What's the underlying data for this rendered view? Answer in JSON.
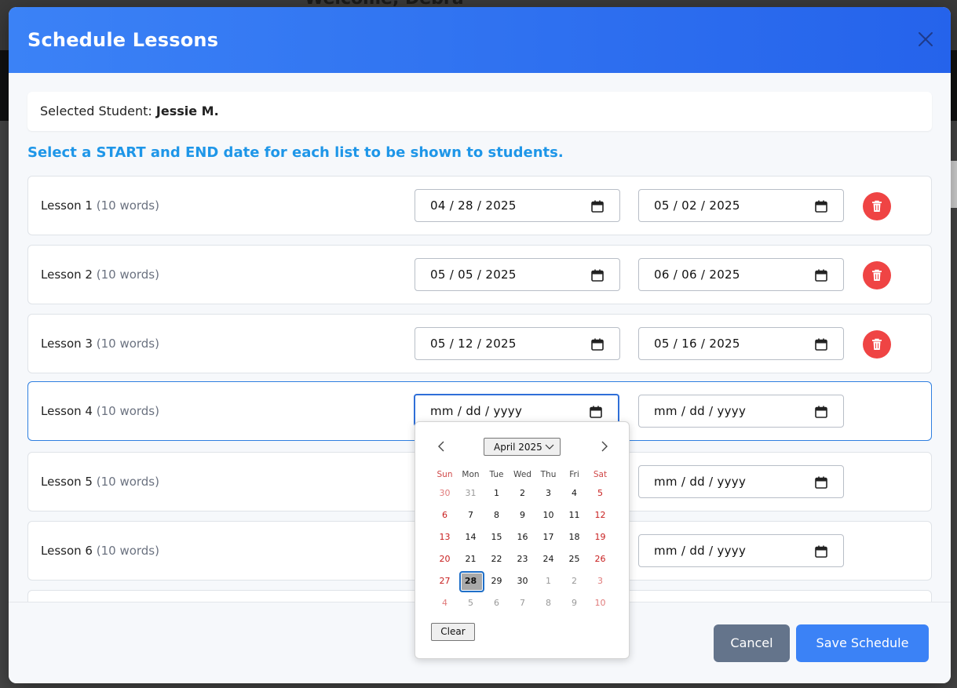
{
  "background": {
    "welcome_text": "Welcome, Debra"
  },
  "modal": {
    "title": "Schedule Lessons",
    "student_label": "Selected Student:",
    "student_name": "Jessie M.",
    "instruction": "Select a START and END date for each list to be shown to students.",
    "lessons": [
      {
        "name": "Lesson 1",
        "count": "(10 words)",
        "start": "04 / 28 / 2025",
        "end": "05 / 02 / 2025"
      },
      {
        "name": "Lesson 2",
        "count": "(10 words)",
        "start": "05 / 05 / 2025",
        "end": "06 / 06 / 2025"
      },
      {
        "name": "Lesson 3",
        "count": "(10 words)",
        "start": "05 / 12 / 2025",
        "end": "05 / 16 / 2025"
      },
      {
        "name": "Lesson 4",
        "count": "(10 words)",
        "start": "mm / dd / yyyy",
        "end": "mm / dd / yyyy"
      },
      {
        "name": "Lesson 5",
        "count": "(10 words)",
        "start": "",
        "end": "mm / dd / yyyy"
      },
      {
        "name": "Lesson 6",
        "count": "(10 words)",
        "start": "",
        "end": "mm / dd / yyyy"
      }
    ],
    "cancel_label": "Cancel",
    "save_label": "Save Schedule"
  },
  "datepicker": {
    "month_label": "April 2025",
    "weekdays": [
      "Sun",
      "Mon",
      "Tue",
      "Wed",
      "Thu",
      "Fri",
      "Sat"
    ],
    "weeks": [
      [
        "30",
        "31",
        "1",
        "2",
        "3",
        "4",
        "5"
      ],
      [
        "6",
        "7",
        "8",
        "9",
        "10",
        "11",
        "12"
      ],
      [
        "13",
        "14",
        "15",
        "16",
        "17",
        "18",
        "19"
      ],
      [
        "20",
        "21",
        "22",
        "23",
        "24",
        "25",
        "26"
      ],
      [
        "27",
        "28",
        "29",
        "30",
        "1",
        "2",
        "3"
      ],
      [
        "4",
        "5",
        "6",
        "7",
        "8",
        "9",
        "10"
      ]
    ],
    "selected_day": "28",
    "clear_label": "Clear"
  },
  "colors": {
    "header_start": "#3b82f6",
    "header_end": "#2563eb",
    "instruction": "#1e96e8",
    "delete": "#ef4444",
    "cancel": "#64748b",
    "save": "#3b82f6"
  }
}
